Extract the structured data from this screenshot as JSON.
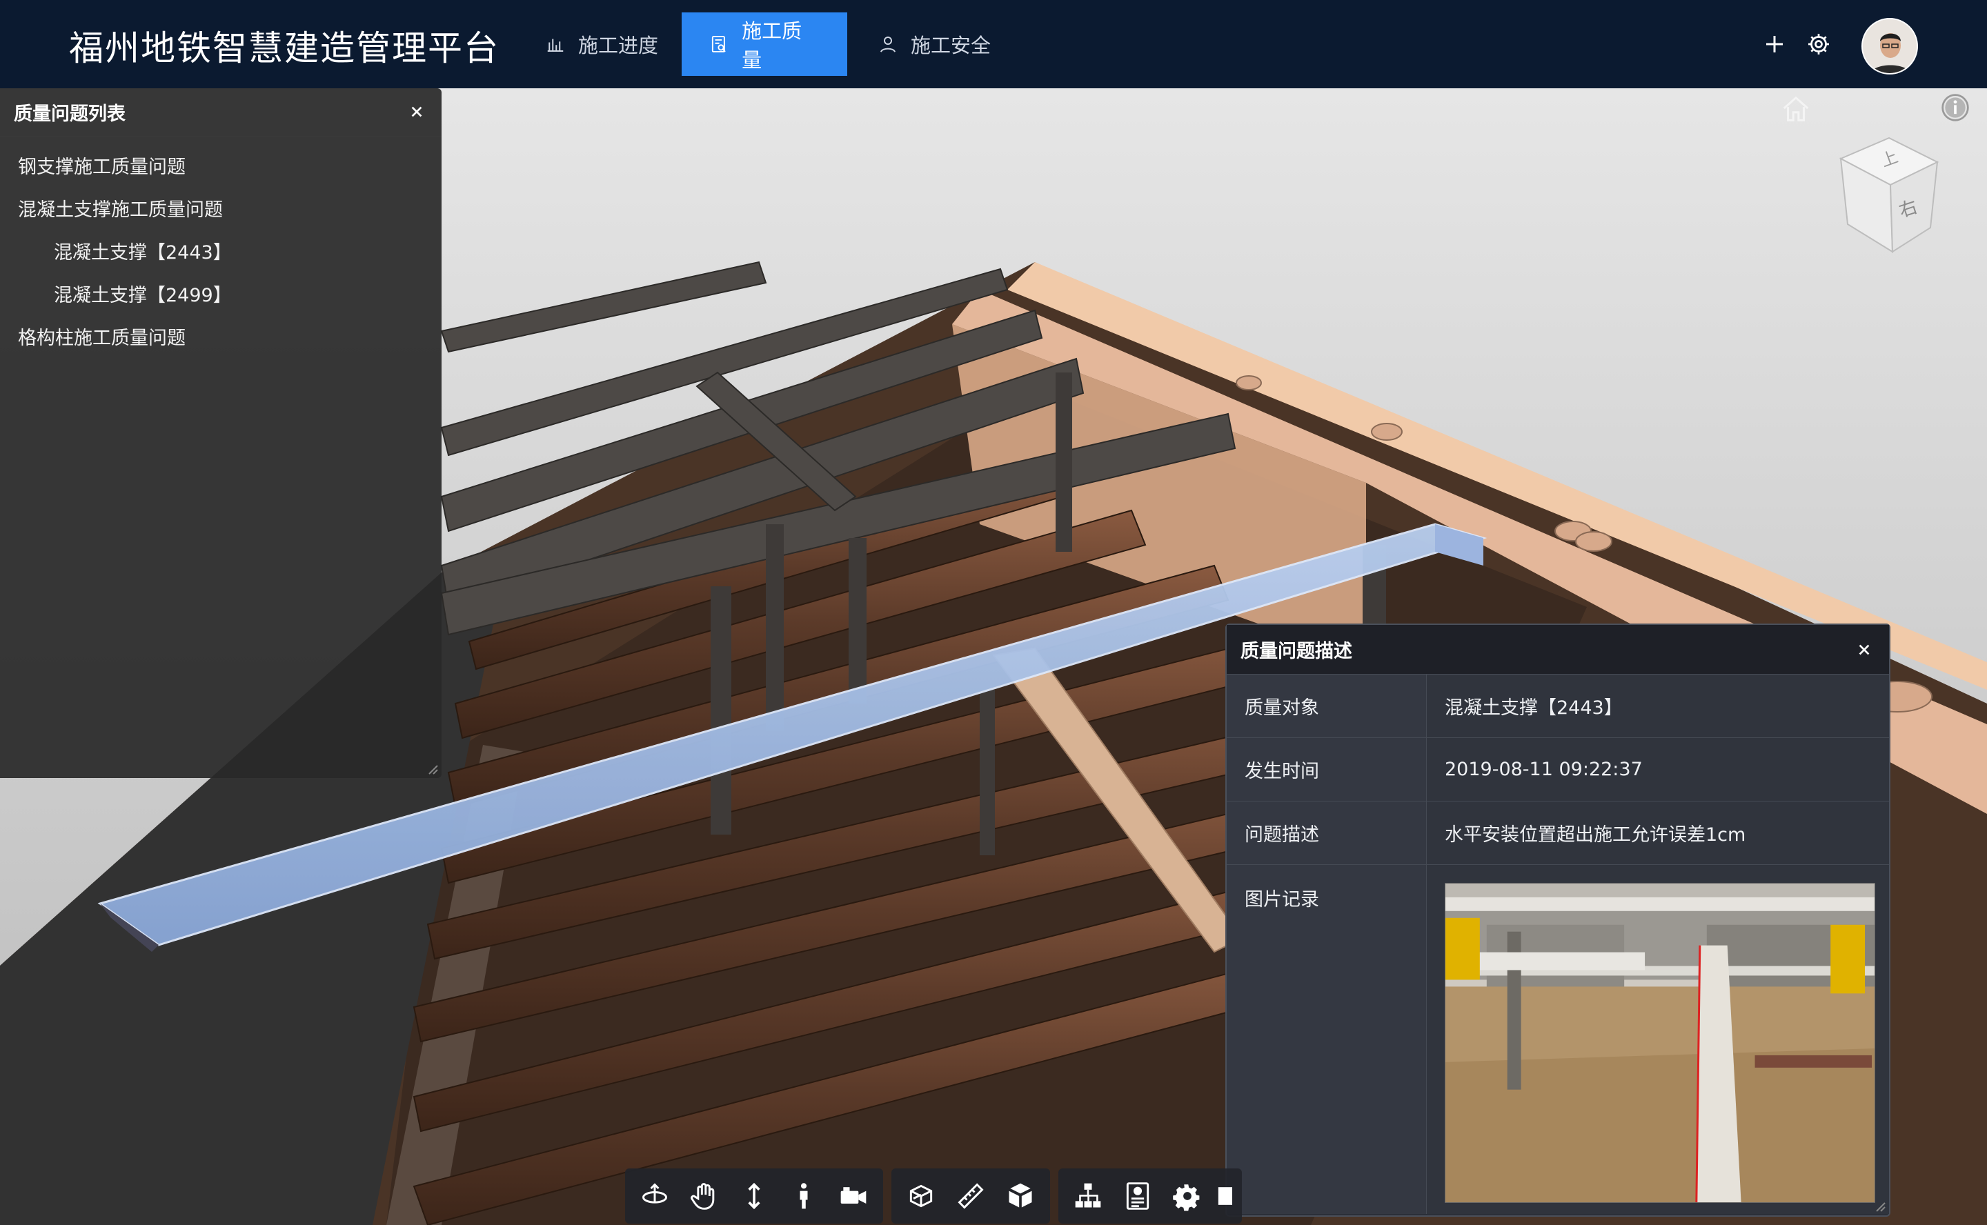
{
  "header": {
    "title": "福州地铁智慧建造管理平台",
    "tabs": [
      {
        "label": "施工进度",
        "icon": "bar-chart-icon",
        "active": false
      },
      {
        "label": "施工质量",
        "icon": "quality-search-icon",
        "active": true
      },
      {
        "label": "施工安全",
        "icon": "user-icon",
        "active": false
      }
    ],
    "actions": [
      "plus-icon",
      "gear-icon"
    ],
    "avatar": "user-avatar"
  },
  "quality_list": {
    "title": "质量问题列表",
    "items": [
      {
        "label": "钢支撑施工质量问题",
        "level": 0
      },
      {
        "label": "混凝土支撑施工质量问题",
        "level": 0
      },
      {
        "label": "混凝土支撑【2443】",
        "level": 1
      },
      {
        "label": "混凝土支撑【2499】",
        "level": 1
      },
      {
        "label": "格构柱施工质量问题",
        "level": 0
      }
    ]
  },
  "viewcube": {
    "top_face": "上",
    "right_face": "右"
  },
  "description": {
    "title": "质量问题描述",
    "rows": [
      {
        "key": "质量对象",
        "value": "混凝土支撑【2443】"
      },
      {
        "key": "发生时间",
        "value": "2019-08-11 09:22:37"
      },
      {
        "key": "问题描述",
        "value": "水平安装位置超出施工允许误差1cm"
      },
      {
        "key": "图片记录",
        "value": ""
      }
    ]
  },
  "toolbar": {
    "groups": [
      [
        "orbit-icon",
        "pan-hand-icon",
        "zoom-updown-icon",
        "walk-person-icon",
        "camera-icon"
      ],
      [
        "section-box-icon",
        "measure-ruler-icon",
        "explode-cube-icon"
      ],
      [
        "model-tree-icon",
        "properties-icon",
        "settings-gear-icon",
        "fullscreen-icon"
      ]
    ]
  },
  "colors": {
    "topbar": "#0b1a30",
    "active_tab": "#2b86f2",
    "highlight_beam": "#9db9e6",
    "concrete_wall": "#e4b79a",
    "pipe": "#6a4531"
  }
}
